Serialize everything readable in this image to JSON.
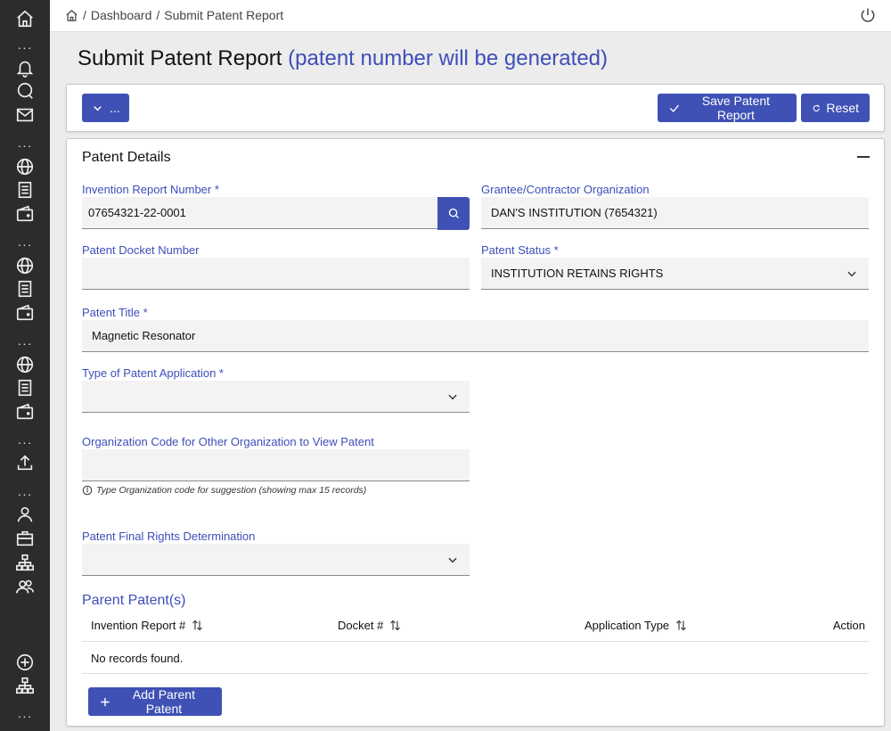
{
  "breadcrumb": {
    "dashboard": "Dashboard",
    "current": "Submit Patent Report"
  },
  "page": {
    "title": "Submit Patent Report",
    "subtitle": "(patent number will be generated)"
  },
  "toolbar": {
    "more_label": "...",
    "save_label": "Save Patent Report",
    "reset_label": "Reset"
  },
  "details": {
    "section_title": "Patent Details",
    "invention_report_number": {
      "label": "Invention Report Number *",
      "value": "07654321-22-0001"
    },
    "organization": {
      "label": "Grantee/Contractor Organization",
      "value": "DAN'S INSTITUTION (7654321)"
    },
    "docket_number": {
      "label": "Patent Docket Number",
      "value": ""
    },
    "patent_status": {
      "label": "Patent Status *",
      "value": "INSTITUTION RETAINS RIGHTS"
    },
    "patent_title": {
      "label": "Patent Title *",
      "value": "Magnetic Resonator"
    },
    "application_type": {
      "label": "Type of Patent Application *",
      "value": ""
    },
    "org_code": {
      "label": "Organization Code for Other Organization to View Patent",
      "value": "",
      "hint": "Type Organization code for suggestion (showing max 15 records)"
    },
    "final_rights": {
      "label": "Patent Final Rights Determination",
      "value": ""
    }
  },
  "parent_patents": {
    "title": "Parent Patent(s)",
    "columns": [
      "Invention Report #",
      "Docket #",
      "Application Type",
      "Action"
    ],
    "empty_message": "No records found.",
    "add_label": "Add Parent Patent"
  },
  "icons": {
    "sidebar": [
      "home-icon",
      "bell-icon",
      "chat-icon",
      "mail-icon",
      "globe-icon",
      "document-icon",
      "wallet-icon",
      "upload-icon",
      "user-icon",
      "briefcase-icon",
      "org-chart-icon",
      "people-icon",
      "add-circle-icon"
    ]
  },
  "colors": {
    "primary": "#3f51b5",
    "label": "#3d4eb8",
    "sidebar": "#2c2c2c",
    "background": "#ececec"
  }
}
